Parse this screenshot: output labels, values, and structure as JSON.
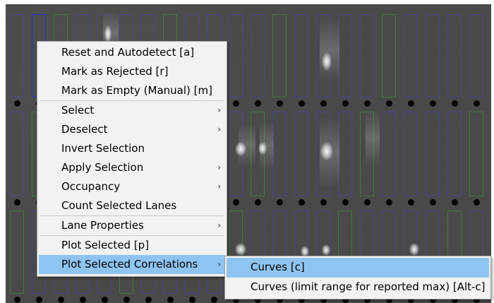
{
  "menu": {
    "groups": [
      [
        {
          "label": "Reset and Autodetect [a]"
        },
        {
          "label": "Mark as Rejected [r]"
        },
        {
          "label": "Mark as Empty (Manual) [m]"
        }
      ],
      [
        {
          "label": "Select",
          "arrow": "›"
        },
        {
          "label": "Deselect",
          "arrow": "›"
        },
        {
          "label": "Invert Selection"
        },
        {
          "label": "Apply Selection",
          "arrow": "›"
        },
        {
          "label": "Occupancy",
          "arrow": "›"
        },
        {
          "label": "Count Selected Lanes"
        }
      ],
      [
        {
          "label": "Lane Properties",
          "arrow": "›"
        }
      ],
      [
        {
          "label": "Plot Selected [p]"
        },
        {
          "label": "Plot Selected Correlations",
          "arrow": "›"
        }
      ]
    ]
  },
  "submenu": {
    "items": [
      {
        "label": "Curves [c]"
      },
      {
        "label": "Curves (limit range for reported max) [Alt-c]"
      }
    ]
  },
  "colors": {
    "menu_bg": "#f2f2f2",
    "highlight": "#8fc4f0",
    "lane_border": "#4646c8",
    "selected_lane_border": "#2b2bd6",
    "image_bg": "#4a4a4a"
  }
}
